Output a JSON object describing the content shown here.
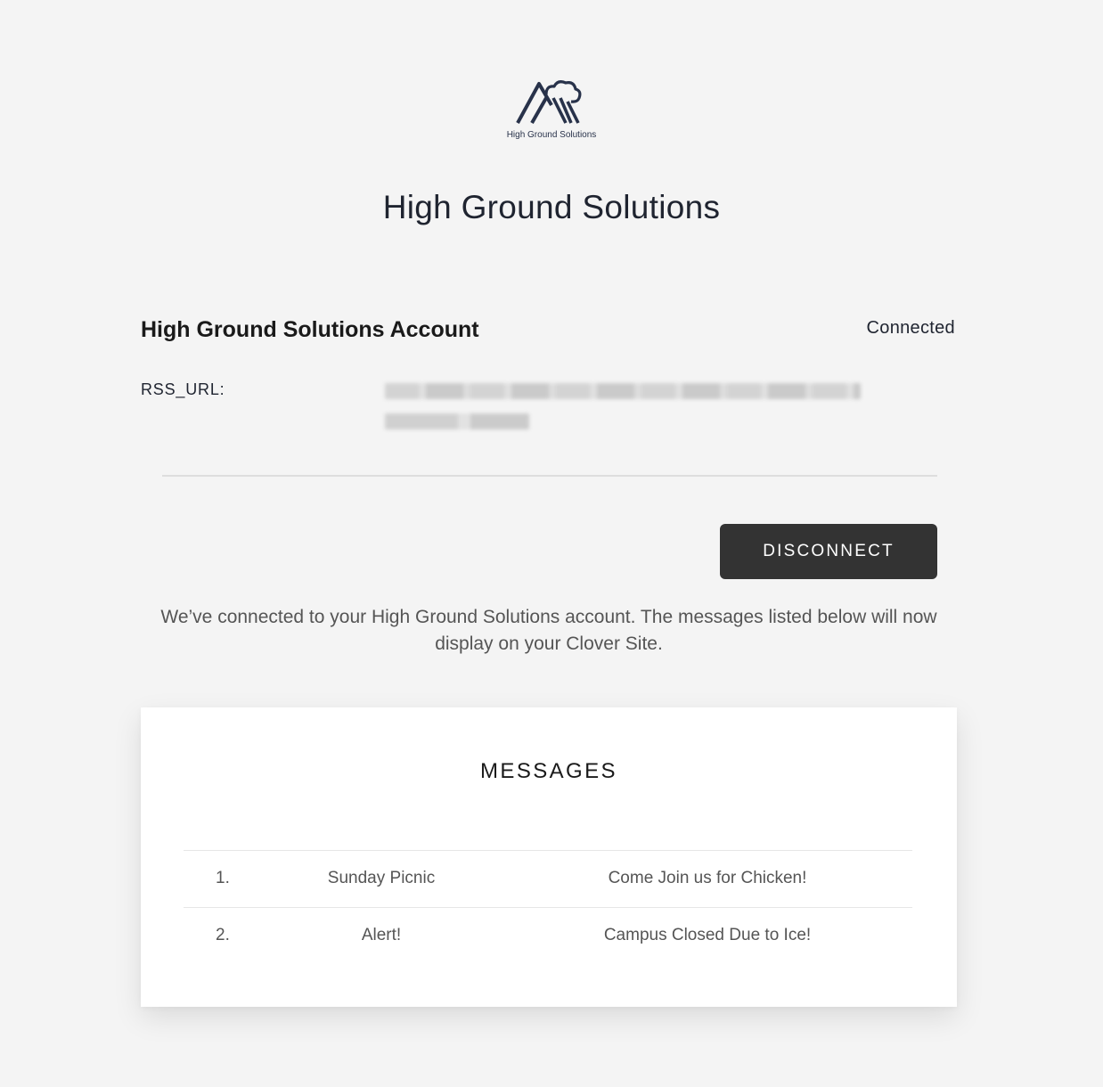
{
  "brand": {
    "logo_caption": "High Ground Solutions",
    "logo_icon": "mountain-cloud-icon",
    "logo_color": "#28324a"
  },
  "header": {
    "title": "High Ground Solutions"
  },
  "account": {
    "title": "High Ground Solutions Account",
    "status": "Connected",
    "rss_label": "RSS_URL:"
  },
  "actions": {
    "disconnect_label": "DISCONNECT",
    "button_color": "#333333"
  },
  "info": {
    "message": "We’ve connected to your High Ground Solutions account. The messages listed below will now display on your Clover Site."
  },
  "messages": {
    "heading": "MESSAGES",
    "items": [
      {
        "number": "1.",
        "title": "Sunday Picnic",
        "body": "Come Join us for Chicken!"
      },
      {
        "number": "2.",
        "title": "Alert!",
        "body": "Campus Closed Due to Ice!"
      }
    ]
  }
}
